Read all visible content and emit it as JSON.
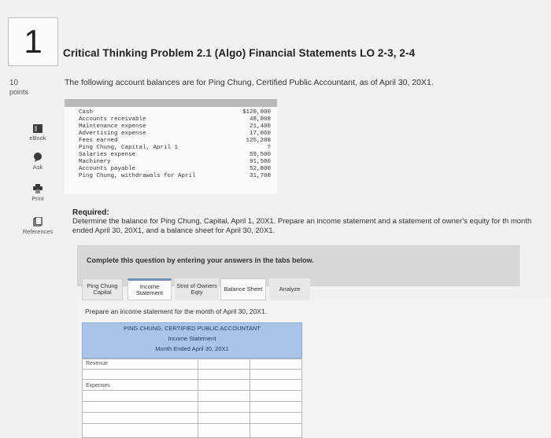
{
  "question": {
    "number": "1",
    "points_value": "10",
    "points_label": "points"
  },
  "sidebar": {
    "tools": [
      {
        "label": "eBook",
        "icon": "book-icon"
      },
      {
        "label": "Ask",
        "icon": "chat-icon"
      },
      {
        "label": "Print",
        "icon": "printer-icon"
      },
      {
        "label": "References",
        "icon": "references-icon"
      }
    ]
  },
  "problem": {
    "title": "Critical Thinking Problem 2.1 (Algo) Financial Statements LO 2-3, 2-4",
    "intro": "The following account balances are for Ping Chung, Certified Public Accountant, as of April 30, 20X1.",
    "accounts": [
      {
        "name": "Cash",
        "amount": "$120,000"
      },
      {
        "name": "Accounts receivable",
        "amount": "48,000"
      },
      {
        "name": "Maintenance expense",
        "amount": "21,400"
      },
      {
        "name": "Advertising expense",
        "amount": "17,060"
      },
      {
        "name": "Fees earned",
        "amount": "125,200"
      },
      {
        "name": "Ping Chung, Capital, April 1",
        "amount": "?"
      },
      {
        "name": "Salaries expense",
        "amount": "59,500"
      },
      {
        "name": "Machinery",
        "amount": "91,500"
      },
      {
        "name": "Accounts payable",
        "amount": "52,800"
      },
      {
        "name": "Ping Chung, withdrawals for April",
        "amount": "31,700"
      }
    ],
    "required_heading": "Required:",
    "required_text": "Determine the balance for Ping Chung, Capital, April 1, 20X1. Prepare an income statement and a statement of owner's equity for th month ended April 30, 20X1, and a balance sheet for April 30, 20X1."
  },
  "answer_area": {
    "instruction": "Complete this question by entering your answers in the tabs below.",
    "tabs": {
      "ping": "Ping Chung Capital",
      "income": "Income Statement",
      "stmt": "Stmt of Owners Eqty",
      "balance": "Balance Sheet",
      "analyze": "Analyze"
    },
    "prepare_text": "Prepare an income statement for the month of April 30, 20X1.",
    "worksheet": {
      "company": "PING CHUNG, CERTIFIED PUBLIC ACCOUNTANT",
      "statement": "Income Statement",
      "period": "Month Ended April 30, 20X1",
      "revenue_label": "Revenue",
      "expenses_label": "Expenses"
    }
  }
}
